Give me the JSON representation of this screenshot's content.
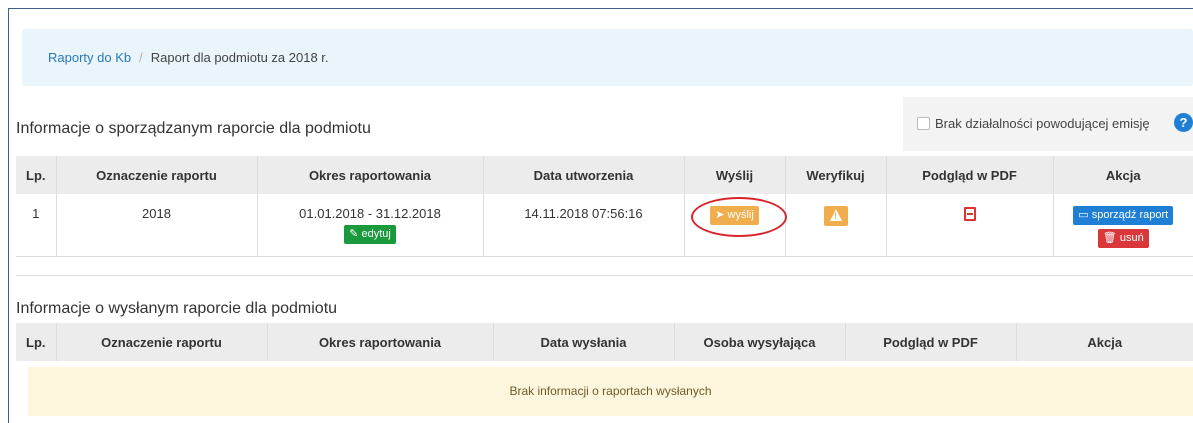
{
  "breadcrumb": {
    "link": "Raporty do Kb",
    "separator": "/",
    "current": "Raport dla podmiotu za 2018 r."
  },
  "emission_checkbox": {
    "label": "Brak działalności powodującej emisję",
    "checked": false,
    "help": "?"
  },
  "section1": {
    "title": "Informacje o sporządzanym raporcie dla podmiotu",
    "columns": [
      "Lp.",
      "Oznaczenie raportu",
      "Okres raportowania",
      "Data utworzenia",
      "Wyślij",
      "Weryfikuj",
      "Podgląd w PDF",
      "Akcja"
    ],
    "row": {
      "lp": "1",
      "oznaczenie": "2018",
      "okres": "01.01.2018 - 31.12.2018",
      "edit_label": "edytuj",
      "data": "14.11.2018 07:56:16",
      "send_label": "wyślij",
      "verify_symbol": "!",
      "prepare_label": "sporządź raport",
      "delete_label": "usuń"
    }
  },
  "section2": {
    "title": "Informacje o wysłanym raporcie dla podmiotu",
    "columns": [
      "Lp.",
      "Oznaczenie raportu",
      "Okres raportowania",
      "Data wysłania",
      "Osoba wysyłająca",
      "Podgląd w PDF",
      "Akcja"
    ],
    "empty": "Brak informacji o raportach wysłanych"
  },
  "colors": {
    "accent": "#1f7fd4",
    "warning": "#f0ad4e",
    "success": "#1a9a3c",
    "danger": "#d9373a",
    "highlight": "#d8242a"
  }
}
